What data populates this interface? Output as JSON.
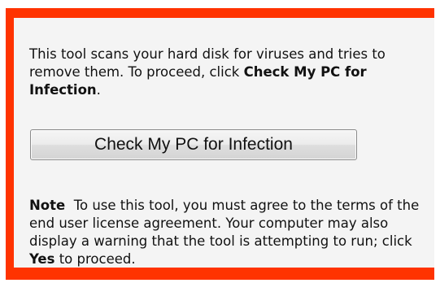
{
  "colors": {
    "border": "#ff3300",
    "panel_background": "#f4f4f4",
    "text": "#111111"
  },
  "intro": {
    "text": "This tool scans your hard disk for viruses and tries to remove them. To proceed, click ",
    "bold": "Check My PC for Infection",
    "end": "."
  },
  "button": {
    "label": "Check My PC for Infection"
  },
  "note": {
    "heading": "Note",
    "text": "  To use this tool, you must agree to the terms of the end user license agreement. Your computer may also display a warning that the tool is attempting to run; click ",
    "bold": "Yes",
    "end": " to proceed."
  }
}
